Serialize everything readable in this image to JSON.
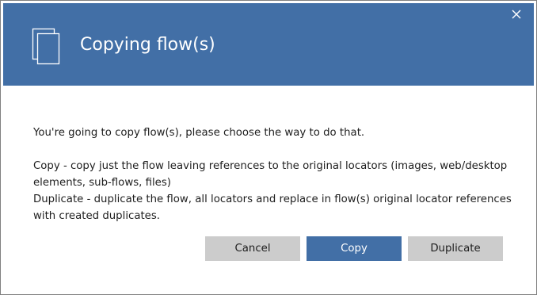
{
  "dialog": {
    "title": "Copying flow(s)",
    "header_icon": "copy-documents-icon",
    "close_icon": "close-icon",
    "accent_color": "#426fa6",
    "message": {
      "intro": "You're going to copy flow(s), please choose the way to do that.",
      "copy_description": "Copy - copy just the flow leaving references to the original locators (images, web/desktop elements, sub-flows, files)",
      "duplicate_description": "Duplicate - duplicate the flow, all locators and replace in flow(s) original locator references with created duplicates."
    },
    "buttons": {
      "cancel": "Cancel",
      "copy": "Copy",
      "duplicate": "Duplicate"
    }
  }
}
